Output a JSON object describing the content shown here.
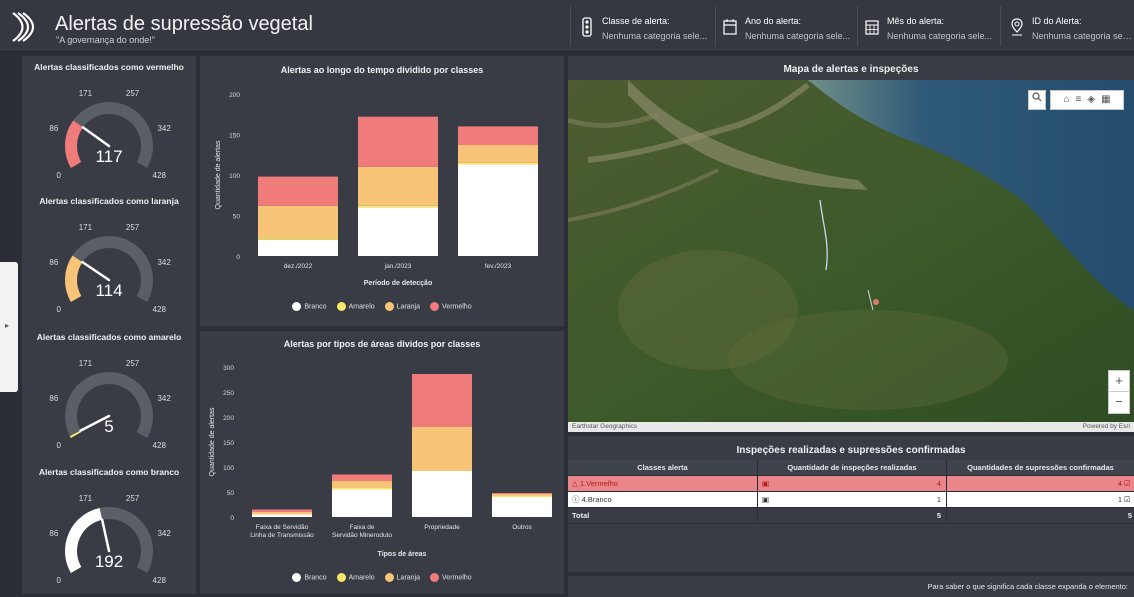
{
  "header": {
    "title": "Alertas de supressão vegetal",
    "subtitle": "\"A governança do onde!\"",
    "filters": [
      {
        "label": "Classe de alerta:",
        "value": "Nenhuma categoria sele...",
        "icon": "traffic-light-icon"
      },
      {
        "label": "Ano do alerta:",
        "value": "Nenhuma categoria sele...",
        "icon": "calendar-icon"
      },
      {
        "label": "Mês do alerta:",
        "value": "Nenhuma categoria sele...",
        "icon": "calendar-grid-icon"
      },
      {
        "label": "ID do Alerta:",
        "value": "Nenhuma categoria sele...",
        "icon": "search-pin-icon"
      }
    ]
  },
  "gauges": [
    {
      "title": "Alertas classificados como vermelho",
      "value": 117,
      "value_label": "117",
      "min": 0,
      "max": 428,
      "ticks": [
        "0",
        "86",
        "171",
        "257",
        "342",
        "428"
      ],
      "color": "#f07b7b"
    },
    {
      "title": "Alertas classificados como laranja",
      "value": 114,
      "value_label": "114",
      "min": 0,
      "max": 428,
      "ticks": [
        "0",
        "86",
        "171",
        "257",
        "342",
        "428"
      ],
      "color": "#f8c477"
    },
    {
      "title": "Alertas classificados como amarelo",
      "value": 5,
      "value_label": "5",
      "min": 0,
      "max": 428,
      "ticks": [
        "0",
        "86",
        "171",
        "257",
        "342",
        "428"
      ],
      "color": "#fbe869"
    },
    {
      "title": "Alertas classificados como branco",
      "value": 192,
      "value_label": "192",
      "min": 0,
      "max": 428,
      "ticks": [
        "0",
        "86",
        "171",
        "257",
        "342",
        "428"
      ],
      "color": "#ffffff"
    }
  ],
  "chart_data": [
    {
      "type": "bar",
      "stacked": true,
      "title": "Alertas ao longo do tempo dividido por classes",
      "xlabel": "Período de detecção",
      "ylabel": "Quantidade de alertas",
      "categories": [
        "dez./2022",
        "jan./2023",
        "fev./2023"
      ],
      "ylim": [
        0,
        200
      ],
      "yticks": [
        0,
        50,
        100,
        150,
        200
      ],
      "series": [
        {
          "name": "Branco",
          "color": "#ffffff",
          "values": [
            20,
            60,
            113
          ]
        },
        {
          "name": "Amarelo",
          "color": "#fbe869",
          "values": [
            2,
            2,
            2
          ]
        },
        {
          "name": "Laranja",
          "color": "#f8c477",
          "values": [
            40,
            48,
            22
          ]
        },
        {
          "name": "Vermelho",
          "color": "#f07b7b",
          "values": [
            36,
            62,
            23
          ]
        }
      ],
      "legend": "bottom"
    },
    {
      "type": "bar",
      "stacked": true,
      "title": "Alertas por tipos de áreas dividos por classes",
      "xlabel": "Tipos de áreas",
      "ylabel": "Quantidade de alertas",
      "categories": [
        "Faixa de Servidão Linha de Transmissão",
        "Faixa de Servidão Mineroduto",
        "Propriedade",
        "Outros"
      ],
      "ylim": [
        0,
        300
      ],
      "yticks": [
        0,
        50,
        100,
        150,
        200,
        250,
        300
      ],
      "series": [
        {
          "name": "Branco",
          "color": "#ffffff",
          "values": [
            5,
            55,
            92,
            40
          ]
        },
        {
          "name": "Amarelo",
          "color": "#fbe869",
          "values": [
            0,
            3,
            0,
            2
          ]
        },
        {
          "name": "Laranja",
          "color": "#f8c477",
          "values": [
            5,
            14,
            88,
            4
          ]
        },
        {
          "name": "Vermelho",
          "color": "#f07b7b",
          "values": [
            5,
            13,
            106,
            2
          ]
        }
      ],
      "legend": "bottom"
    }
  ],
  "map": {
    "title": "Mapa de alertas e inspeções",
    "attribution_left": "Earthstar Geographics",
    "attribution_right": "Powered by Esri",
    "zoom_in": "+",
    "zoom_out": "−"
  },
  "table": {
    "title": "Inspeções realizadas e supressões confirmadas",
    "headers": [
      "Classes alerta",
      "Quantidade de inspeções realizadas",
      "Quantidades de supressões confirmadas"
    ],
    "rows": [
      {
        "class": "1.Vermelho",
        "inspections": "4",
        "suppressions": "4"
      },
      {
        "class": "4.Branco",
        "inspections": "1",
        "suppressions": "1"
      }
    ],
    "total_label": "Total",
    "total_inspections": "5",
    "total_suppressions": "5"
  },
  "info": {
    "text": "Para saber o que significa cada classe expanda o elemento:"
  }
}
